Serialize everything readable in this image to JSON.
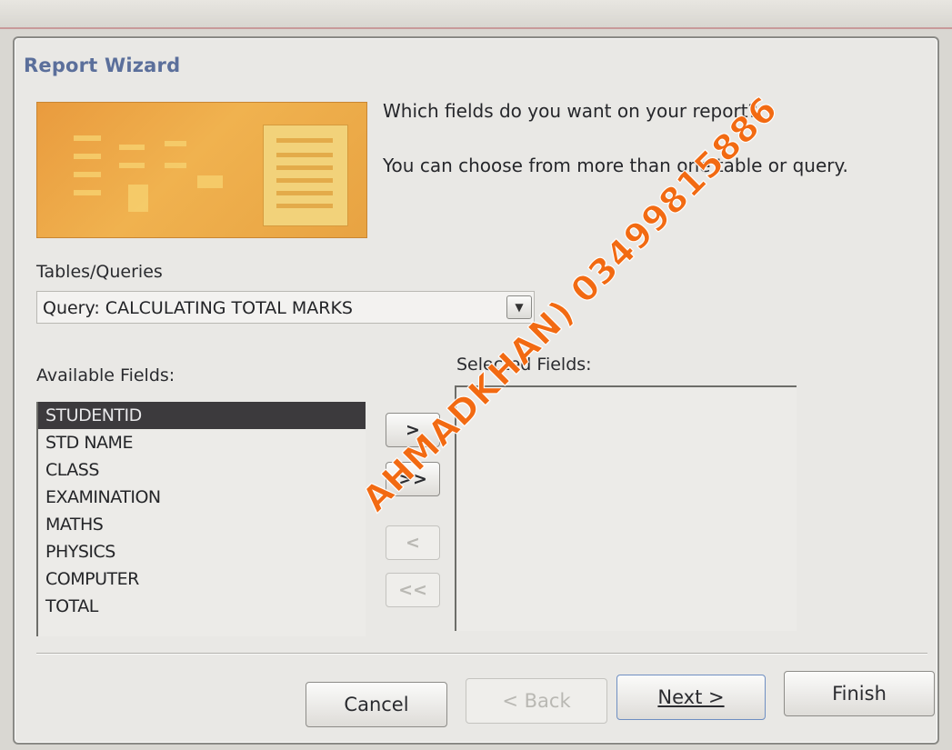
{
  "window": {
    "title": "Report Wizard"
  },
  "prompt": {
    "line1": "Which fields do you want on your report?",
    "line2": "You can choose from more than one table or query."
  },
  "tables_queries": {
    "label": "Tables/Queries",
    "selected": "Query: CALCULATING TOTAL MARKS",
    "dropdown_icon": "chevron-down-icon"
  },
  "available": {
    "label": "Available Fields:",
    "items": [
      "STUDENTID",
      "STD NAME",
      "CLASS",
      "EXAMINATION",
      "MATHS",
      "PHYSICS",
      "COMPUTER",
      "TOTAL"
    ],
    "selected_index": 0
  },
  "selected_fields": {
    "label": "Selected Fields:",
    "items": []
  },
  "move": {
    "add_one": ">",
    "add_all": ">>",
    "remove_one": "<",
    "remove_all": "<<"
  },
  "footer": {
    "cancel": "Cancel",
    "back": "< Back",
    "next": "Next >",
    "finish": "Finish"
  },
  "watermark": "AHMADKHAN) 03499815886",
  "colors": {
    "title": "#5b6f9b",
    "banner": "#e99b3e",
    "selection": "#3c3a3d",
    "watermark": "#f26a12"
  }
}
